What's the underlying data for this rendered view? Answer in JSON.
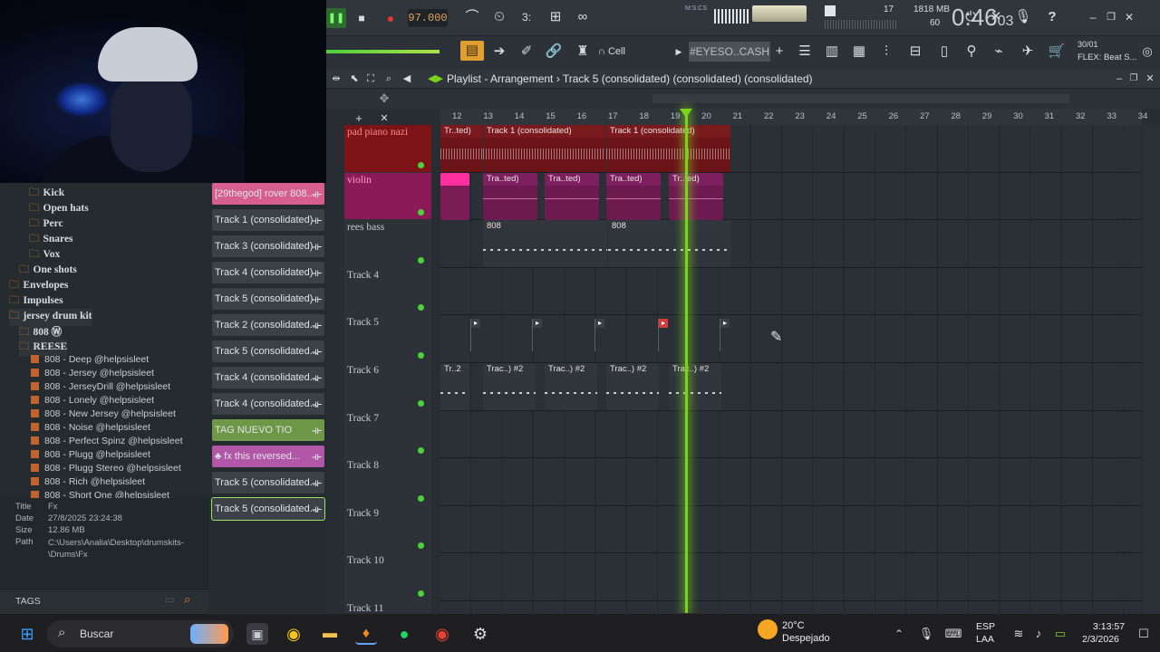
{
  "topbar": {
    "tempo": "97.000",
    "time": "0:46",
    "time_small": "03",
    "time_unit_label": "M:S:CS",
    "cpu_voices": "17",
    "memory": "1818 MB",
    "polyphony": "60",
    "pattern_name": "#EYESO..CASH",
    "snap_mode": "Cell",
    "hint_counter": "30/01",
    "hint_text": "FLEX: Beat S..."
  },
  "window": {
    "title": "Playlist - Arrangement",
    "subtitle": "Track 5 (consolidated) (consolidated) (consolidated)"
  },
  "browser": {
    "folders": [
      {
        "label": "Kick",
        "indent": 2
      },
      {
        "label": "Open hats",
        "indent": 2
      },
      {
        "label": "Perc",
        "indent": 2
      },
      {
        "label": "Snares",
        "indent": 2
      },
      {
        "label": "Vox",
        "indent": 2
      },
      {
        "label": "One shots",
        "indent": 1
      },
      {
        "label": "Envelopes",
        "indent": 0
      },
      {
        "label": "Impulses",
        "indent": 0
      },
      {
        "label": "jersey drum kit",
        "indent": 0
      },
      {
        "label": "808 Ⓦ",
        "indent": 1
      },
      {
        "label": "REESE",
        "indent": 1
      }
    ],
    "files": [
      "808 - Deep @helpsisleet",
      "808 - Jersey @helpsisleet",
      "808 - JerseyDrill @helpsisleet",
      "808 - Lonely @helpsisleet",
      "808 - New Jersey @helpsisleet",
      "808 - Noise @helpsisleet",
      "808 - Perfect Spinz @helpsisleet",
      "808 - Plugg @helpsisleet",
      "808 - Plugg Stereo @helpsisleet",
      "808 - Rich @helpsisleet",
      "808 - Short One @helpsisleet"
    ],
    "info": {
      "title_key": "Title",
      "title_val": "Fx",
      "date_key": "Date",
      "date_val": "27/8/2025 23:24:38",
      "size_key": "Size",
      "size_val": "12.86 MB",
      "path_key": "Path",
      "path_val": "C:\\Users\\Analia\\Desktop\\drumskits-\n\\Drums\\Fx"
    },
    "tags_label": "TAGS"
  },
  "picker": [
    {
      "label": "[29thegod] rover 808...",
      "color": "#d65f90"
    },
    {
      "label": "Track 1 (consolidated)",
      "color": "#3b4147"
    },
    {
      "label": "Track 3 (consolidated)",
      "color": "#3b4147"
    },
    {
      "label": "Track 4 (consolidated)",
      "color": "#3b4147"
    },
    {
      "label": "Track 5 (consolidated)",
      "color": "#3b4147"
    },
    {
      "label": "Track 2 (consolidated...",
      "color": "#3b4147"
    },
    {
      "label": "Track 5 (consolidated...",
      "color": "#3b4147"
    },
    {
      "label": "Track 4 (consolidated...",
      "color": "#3b4147"
    },
    {
      "label": "Track 4 (consolidated...",
      "color": "#3b4147"
    },
    {
      "label": "TAG NUEVO TIO",
      "color": "#6e9848"
    },
    {
      "label": "♣ fx this reversed...",
      "color": "#b257a8"
    },
    {
      "label": "Track 5 (consolidated...",
      "color": "#3b4147"
    },
    {
      "label": "Track 5 (consolidated...",
      "color": "#3b4147"
    }
  ],
  "ruler": [
    "12",
    "13",
    "14",
    "15",
    "16",
    "17",
    "18",
    "19",
    "20",
    "21",
    "22",
    "23",
    "24",
    "25",
    "26",
    "27",
    "28",
    "29",
    "30",
    "31",
    "32",
    "33",
    "34"
  ],
  "tracks": [
    {
      "name": "pad piano nazi",
      "color": "#7d1317"
    },
    {
      "name": "violin",
      "color": "#8a1a58"
    },
    {
      "name": "rees bass",
      "color": "#2c3237"
    },
    {
      "name": "Track 4",
      "color": "#2c3237"
    },
    {
      "name": "Track 5",
      "color": "#2c3237"
    },
    {
      "name": "Track 6",
      "color": "#2c3237"
    },
    {
      "name": "Track 7",
      "color": "#2c3237"
    },
    {
      "name": "Track 8",
      "color": "#2c3237"
    },
    {
      "name": "Track 9",
      "color": "#2c3237"
    },
    {
      "name": "Track 10",
      "color": "#2c3237"
    },
    {
      "name": "Track 11",
      "color": "#2c3237"
    }
  ],
  "clips": {
    "pad_label_a": "Tr..ted)",
    "pad_label_b": "Track 1 (consolidated)",
    "violin_label": "Tra..ted)",
    "violin_label_last": "Tr..ted)",
    "bass_label": "808",
    "track6_label_first": "Tr..2",
    "track6_label": "Trac..) #2"
  },
  "taskbar": {
    "search_placeholder": "Buscar",
    "weather_temp": "20°C",
    "weather_desc": "Despejado",
    "lang_top": "ESP",
    "lang_bottom": "LAA",
    "clock_time": "3:13:57",
    "clock_date": "2/3/2026"
  }
}
